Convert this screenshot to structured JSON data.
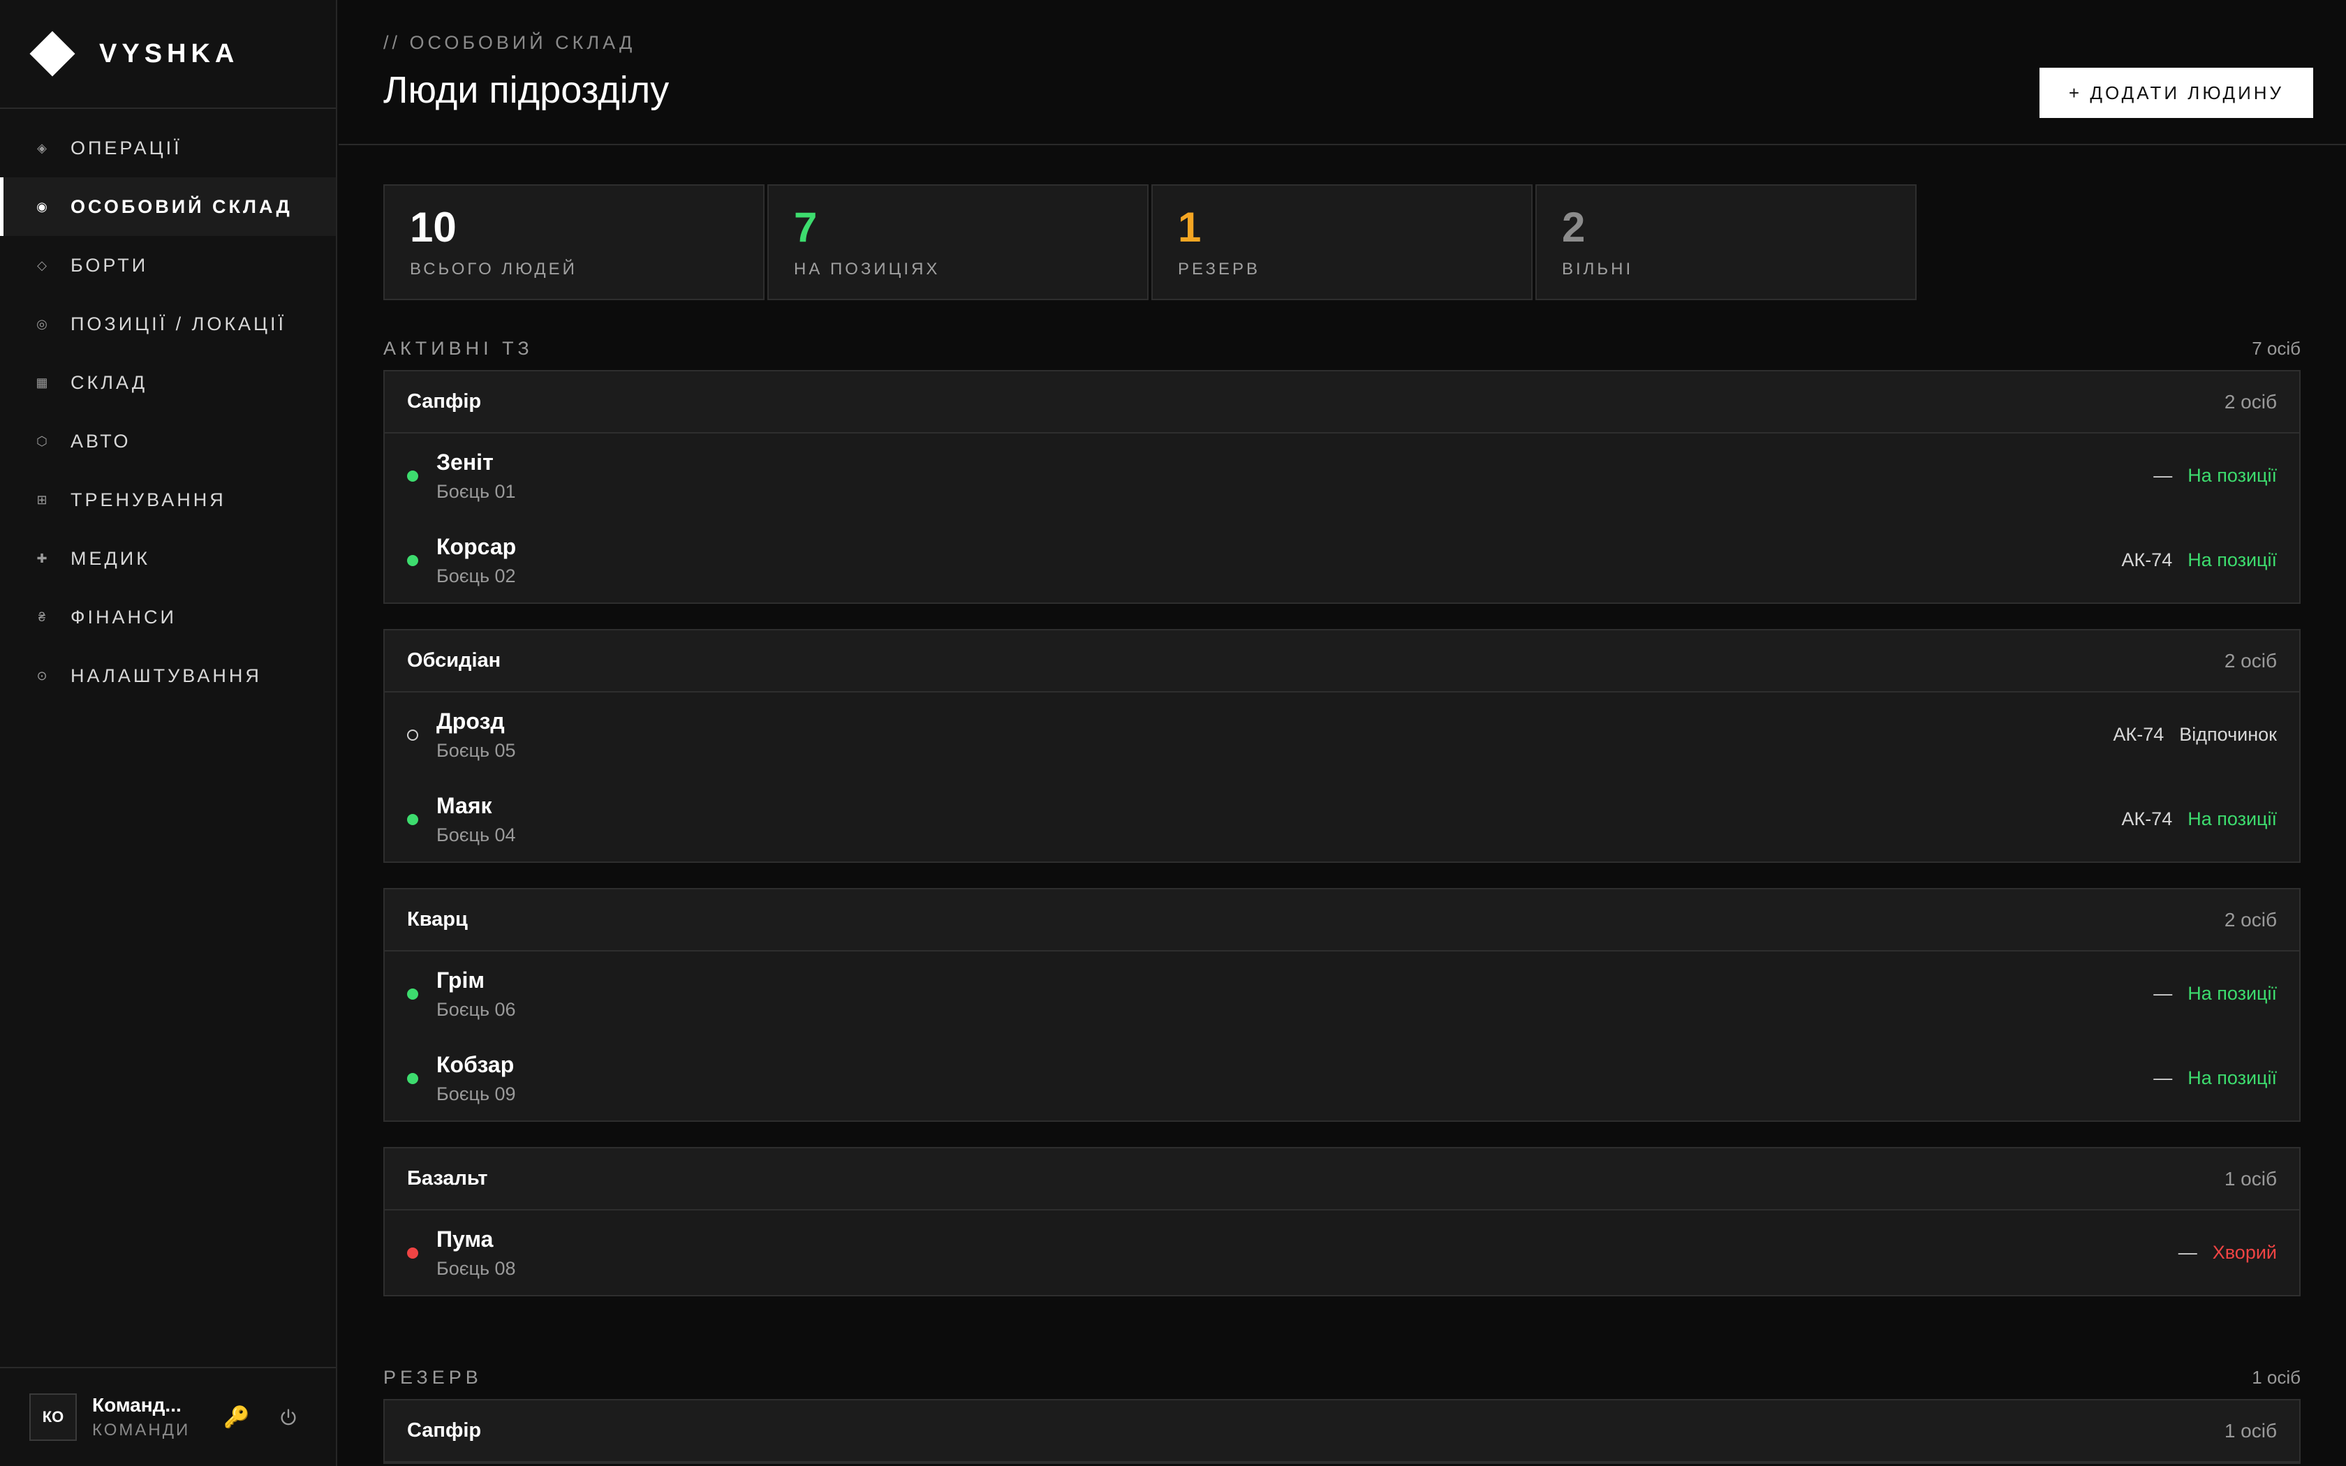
{
  "brand": {
    "name": "VYSHKA"
  },
  "nav": [
    {
      "label": "ОПЕРАЦІЇ",
      "icon": "◈",
      "icon_name": "operations-icon",
      "active": false
    },
    {
      "label": "ОСОБОВИЙ СКЛАД",
      "icon": "◉",
      "icon_name": "personnel-icon",
      "active": true
    },
    {
      "label": "БОРТИ",
      "icon": "◇",
      "icon_name": "aircraft-icon",
      "active": false
    },
    {
      "label": "ПОЗИЦІЇ / ЛОКАЦІЇ",
      "icon": "◎",
      "icon_name": "positions-icon",
      "active": false
    },
    {
      "label": "СКЛАД",
      "icon": "▦",
      "icon_name": "warehouse-icon",
      "active": false
    },
    {
      "label": "АВТО",
      "icon": "⬡",
      "icon_name": "vehicle-icon",
      "active": false
    },
    {
      "label": "ТРЕНУВАННЯ",
      "icon": "⊞",
      "icon_name": "training-icon",
      "active": false
    },
    {
      "label": "МЕДИК",
      "icon": "✚",
      "icon_name": "medic-icon",
      "active": false
    },
    {
      "label": "ФІНАНСИ",
      "icon": "₴",
      "icon_name": "finance-icon",
      "active": false
    },
    {
      "label": "НАЛАШТУВАННЯ",
      "icon": "⊙",
      "icon_name": "settings-icon",
      "active": false
    }
  ],
  "user": {
    "initials": "КО",
    "name": "Команд...",
    "role": "КОМАНДИ"
  },
  "header": {
    "breadcrumb": "// ОСОБОВИЙ СКЛАД",
    "title": "Люди підрозділу",
    "add_button": "+ ДОДАТИ ЛЮДИНУ"
  },
  "stats": [
    {
      "value": "10",
      "label": "ВСЬОГО ЛЮДЕЙ",
      "color": "#ffffff"
    },
    {
      "value": "7",
      "label": "НА ПОЗИЦІЯХ",
      "color": "#3ddc6e"
    },
    {
      "value": "1",
      "label": "РЕЗЕРВ",
      "color": "#f5a623"
    },
    {
      "value": "2",
      "label": "ВІЛЬНІ",
      "color": "#8c8c8c"
    }
  ],
  "active_section": {
    "title": "АКТИВНІ ТЗ",
    "count": "7 осіб",
    "groups": [
      {
        "name": "Сапфір",
        "count": "2 осіб",
        "people": [
          {
            "name": "Зеніт",
            "role": "Боєць 01",
            "weapon": "—",
            "status": "На позиції",
            "dot": "green",
            "status_color": "#3ddc6e"
          },
          {
            "name": "Корсар",
            "role": "Боєць 02",
            "weapon": "АК-74",
            "status": "На позиції",
            "dot": "green",
            "status_color": "#3ddc6e"
          }
        ]
      },
      {
        "name": "Обсидіан",
        "count": "2 осіб",
        "people": [
          {
            "name": "Дрозд",
            "role": "Боєць 05",
            "weapon": "АК-74",
            "status": "Відпочинок",
            "dot": "empty",
            "status_color": "#d8d8d8"
          },
          {
            "name": "Маяк",
            "role": "Боєць 04",
            "weapon": "АК-74",
            "status": "На позиції",
            "dot": "green",
            "status_color": "#3ddc6e"
          }
        ]
      },
      {
        "name": "Кварц",
        "count": "2 осіб",
        "people": [
          {
            "name": "Грім",
            "role": "Боєць 06",
            "weapon": "—",
            "status": "На позиції",
            "dot": "green",
            "status_color": "#3ddc6e"
          },
          {
            "name": "Кобзар",
            "role": "Боєць 09",
            "weapon": "—",
            "status": "На позиції",
            "dot": "green",
            "status_color": "#3ddc6e"
          }
        ]
      },
      {
        "name": "Базальт",
        "count": "1 осіб",
        "people": [
          {
            "name": "Пума",
            "role": "Боєць 08",
            "weapon": "—",
            "status": "Хворий",
            "dot": "red",
            "status_color": "#ef4444"
          }
        ]
      }
    ]
  },
  "reserve_section": {
    "title": "РЕЗЕРВ",
    "count": "1 осіб",
    "groups": [
      {
        "name": "Сапфір",
        "count": "1 осіб",
        "people": []
      }
    ]
  }
}
